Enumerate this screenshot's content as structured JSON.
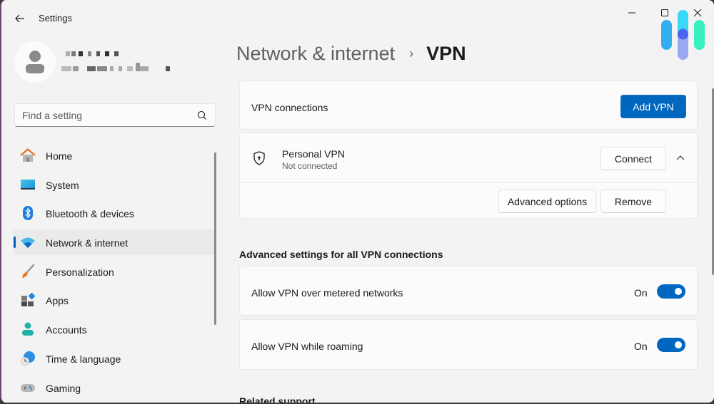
{
  "titlebar": {
    "app_title": "Settings",
    "back_icon": "arrow-left-icon",
    "minimize_icon": "minimize-icon",
    "maximize_icon": "maximize-icon",
    "close_icon": "close-icon"
  },
  "profile": {
    "avatar_icon": "user-avatar-icon",
    "name": "(redacted)",
    "email": "(redacted)"
  },
  "search": {
    "placeholder": "Find a setting",
    "value": "",
    "icon": "search-icon"
  },
  "sidebar": {
    "items": [
      {
        "label": "Home",
        "icon": "home-icon",
        "active": false
      },
      {
        "label": "System",
        "icon": "system-icon",
        "active": false
      },
      {
        "label": "Bluetooth & devices",
        "icon": "bluetooth-icon",
        "active": false
      },
      {
        "label": "Network & internet",
        "icon": "wifi-icon",
        "active": true
      },
      {
        "label": "Personalization",
        "icon": "brush-icon",
        "active": false
      },
      {
        "label": "Apps",
        "icon": "apps-icon",
        "active": false
      },
      {
        "label": "Accounts",
        "icon": "accounts-icon",
        "active": false
      },
      {
        "label": "Time & language",
        "icon": "time-language-icon",
        "active": false
      },
      {
        "label": "Gaming",
        "icon": "gamepad-icon",
        "active": false
      }
    ]
  },
  "breadcrumb": {
    "parent": "Network & internet",
    "separator": "›",
    "current": "VPN"
  },
  "vpn_connections": {
    "label": "VPN connections",
    "add_button": "Add VPN"
  },
  "vpn_entry": {
    "name": "Personal VPN",
    "status": "Not connected",
    "icon": "shield-lock-icon",
    "connect_button": "Connect",
    "expand_icon": "chevron-up-icon",
    "advanced_button": "Advanced options",
    "remove_button": "Remove"
  },
  "advanced": {
    "title": "Advanced settings for all VPN connections",
    "settings": [
      {
        "label": "Allow VPN over metered networks",
        "state": "On",
        "enabled": true
      },
      {
        "label": "Allow VPN while roaming",
        "state": "On",
        "enabled": true
      }
    ]
  },
  "related": {
    "title": "Related support"
  },
  "colors": {
    "accent": "#0067c0",
    "background": "#f3f3f3",
    "card": "#fbfbfb",
    "active_indicator": "#005fb8"
  }
}
